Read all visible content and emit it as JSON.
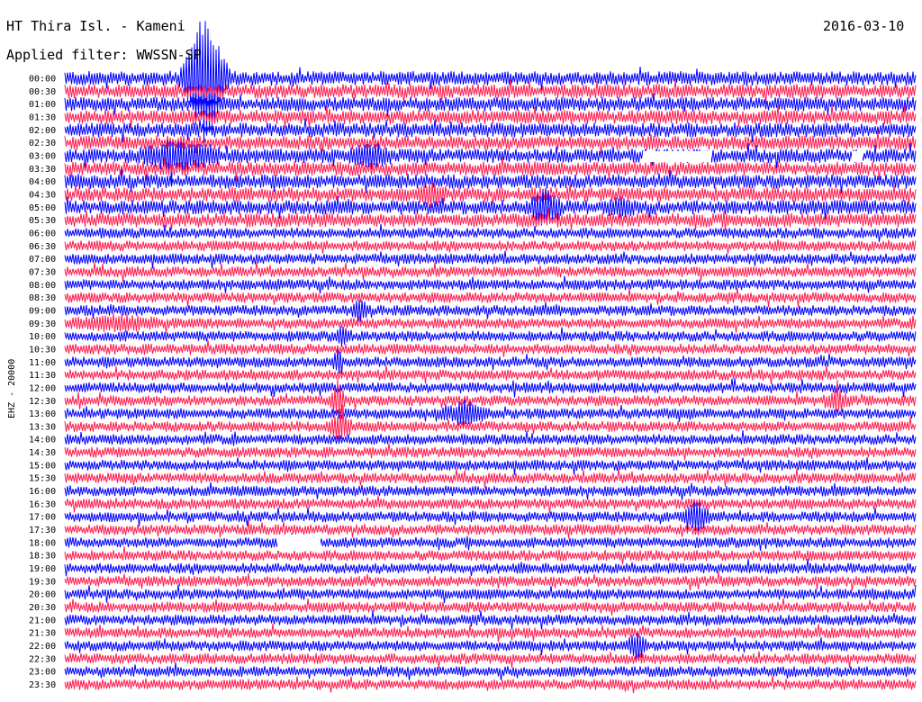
{
  "header": {
    "station": "HT Thira Isl. - Kameni",
    "date": "2016-03-10",
    "filter": "Applied filter: WWSSN-SP"
  },
  "chart_data": {
    "type": "helicorder",
    "title": "HT Thira Isl. - Kameni",
    "date": "2016-03-10",
    "ylabel": "EHZ - 20000",
    "colors": {
      "odd": "#0000ff",
      "even": "#ff1a4d"
    },
    "rows": [
      "00:00",
      "00:30",
      "01:00",
      "01:30",
      "02:00",
      "02:30",
      "03:00",
      "03:30",
      "04:00",
      "04:30",
      "05:00",
      "05:30",
      "06:00",
      "06:30",
      "07:00",
      "07:30",
      "08:00",
      "08:30",
      "09:00",
      "09:30",
      "10:00",
      "10:30",
      "11:00",
      "11:30",
      "12:00",
      "12:30",
      "13:00",
      "13:30",
      "14:00",
      "14:30",
      "15:00",
      "15:30",
      "16:00",
      "16:30",
      "17:00",
      "17:30",
      "18:00",
      "18:30",
      "19:00",
      "19:30",
      "20:00",
      "20:30",
      "21:00",
      "21:30",
      "22:00",
      "22:30",
      "23:00",
      "23:30"
    ]
  }
}
